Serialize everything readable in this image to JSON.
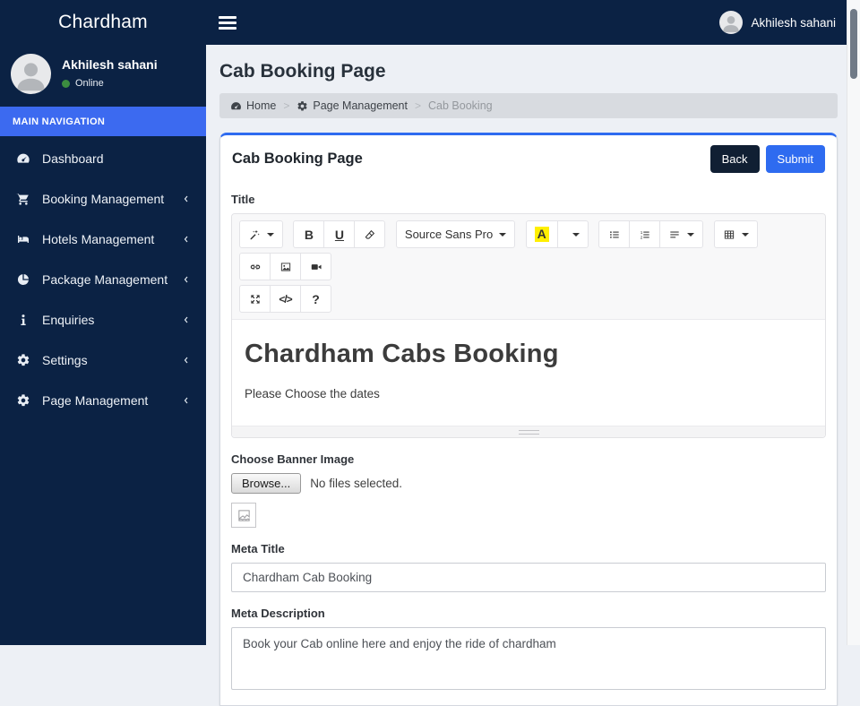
{
  "brand": "Chardham",
  "navbar": {
    "user_name": "Akhilesh sahani"
  },
  "sidebar": {
    "user": {
      "name": "Akhilesh sahani",
      "status": "Online"
    },
    "section_label": "MAIN NAVIGATION",
    "items": [
      {
        "label": "Dashboard",
        "icon": "tachometer-icon",
        "has_children": false
      },
      {
        "label": "Booking Management",
        "icon": "cart-icon",
        "has_children": true
      },
      {
        "label": "Hotels Management",
        "icon": "bed-icon",
        "has_children": true
      },
      {
        "label": "Package Management",
        "icon": "pie-chart-icon",
        "has_children": true
      },
      {
        "label": "Enquiries",
        "icon": "info-icon",
        "has_children": true
      },
      {
        "label": "Settings",
        "icon": "gear-icon",
        "has_children": true
      },
      {
        "label": "Page Management",
        "icon": "gear-icon",
        "has_children": true
      }
    ]
  },
  "content": {
    "page_title": "Cab Booking Page",
    "breadcrumb": {
      "separator": ">",
      "items": [
        {
          "label": "Home",
          "icon": "tachometer-icon"
        },
        {
          "label": "Page Management",
          "icon": "gear-icon"
        },
        {
          "label": "Cab Booking",
          "icon": ""
        }
      ]
    },
    "card": {
      "title": "Cab Booking Page",
      "back_label": "Back",
      "submit_label": "Submit",
      "title_label": "Title",
      "editor": {
        "font_name": "Source Sans Pro",
        "bold_glyph": "B",
        "underline_glyph": "U",
        "color_glyph": "A",
        "codeview_glyph": "</>",
        "help_glyph": "?",
        "heading": "Chardham Cabs Booking",
        "paragraph": "Please Choose the dates"
      },
      "banner_label": "Choose Banner Image",
      "browse_label": "Browse...",
      "no_file_text": "No files selected.",
      "meta_title_label": "Meta Title",
      "meta_title_value": "Chardham Cab Booking",
      "meta_description_label": "Meta Description",
      "meta_description_value": "Book your Cab online here and enjoy the ride of chardham"
    }
  },
  "colors": {
    "navy": "#0b2244",
    "accent_blue": "#2e6bf0",
    "nav_section_blue": "#3c6af0",
    "back_button": "#101f33",
    "online_green": "#3c8d40",
    "highlight_yellow": "#ffef00",
    "content_bg": "#edf0f5",
    "breadcrumb_bg": "#d8dbe0"
  }
}
